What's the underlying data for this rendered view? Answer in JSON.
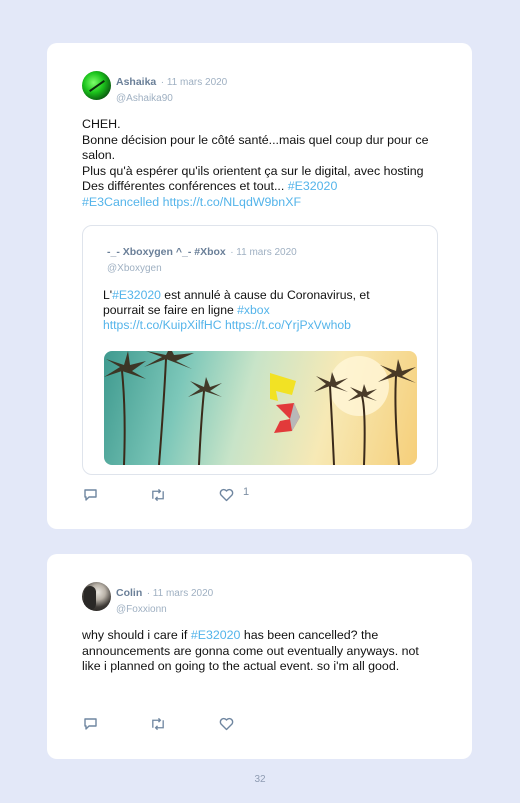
{
  "tweet1": {
    "author": "Ashaika",
    "date": "· 11 mars 2020",
    "handle": "@Ashaika90",
    "text_line1": "CHEH.",
    "text_line2": "Bonne décision pour le côté santé...mais quel coup dur pour ce salon.",
    "text_line3": "Plus qu'à espérer qu'ils orientent ça sur le digital, avec hosting Des différentes conférences et tout... ",
    "hashtag1": "#E32020",
    "hashtag2": "#E3Cancelled",
    "link": "https://t.co/NLqdW9bnXF",
    "quoted": {
      "author": "-_- Xboxygen ^_- #Xbox",
      "date": "· 11 mars 2020",
      "handle": "@Xboxygen",
      "text_a": "L'",
      "hashtag1": "#E32020",
      "text_b": " est annulé à cause du Coronavirus, et pourrait se faire en ligne ",
      "hashtag2": "#xbox",
      "link1": "https://t.co/KuipXilfHC",
      "link2": "https://t.co/YrjPxVwhob",
      "image": "E3 logo over palm trees at sunset"
    },
    "likes": "1"
  },
  "tweet2": {
    "author": "Colin",
    "date": "· 11 mars 2020",
    "handle": "@Foxxionn",
    "text_a": "why should i care if ",
    "hashtag": "#E32020",
    "text_b": " has been cancelled? the announcements are gonna come out eventually anyways. not like i planned on going to the actual event. so i'm all good."
  },
  "page_number": "32",
  "icons": [
    "reply-icon",
    "retweet-icon",
    "like-icon"
  ],
  "colors": {
    "background": "#e3e8f8",
    "link": "#54b4ea",
    "card": "#ffffff"
  }
}
